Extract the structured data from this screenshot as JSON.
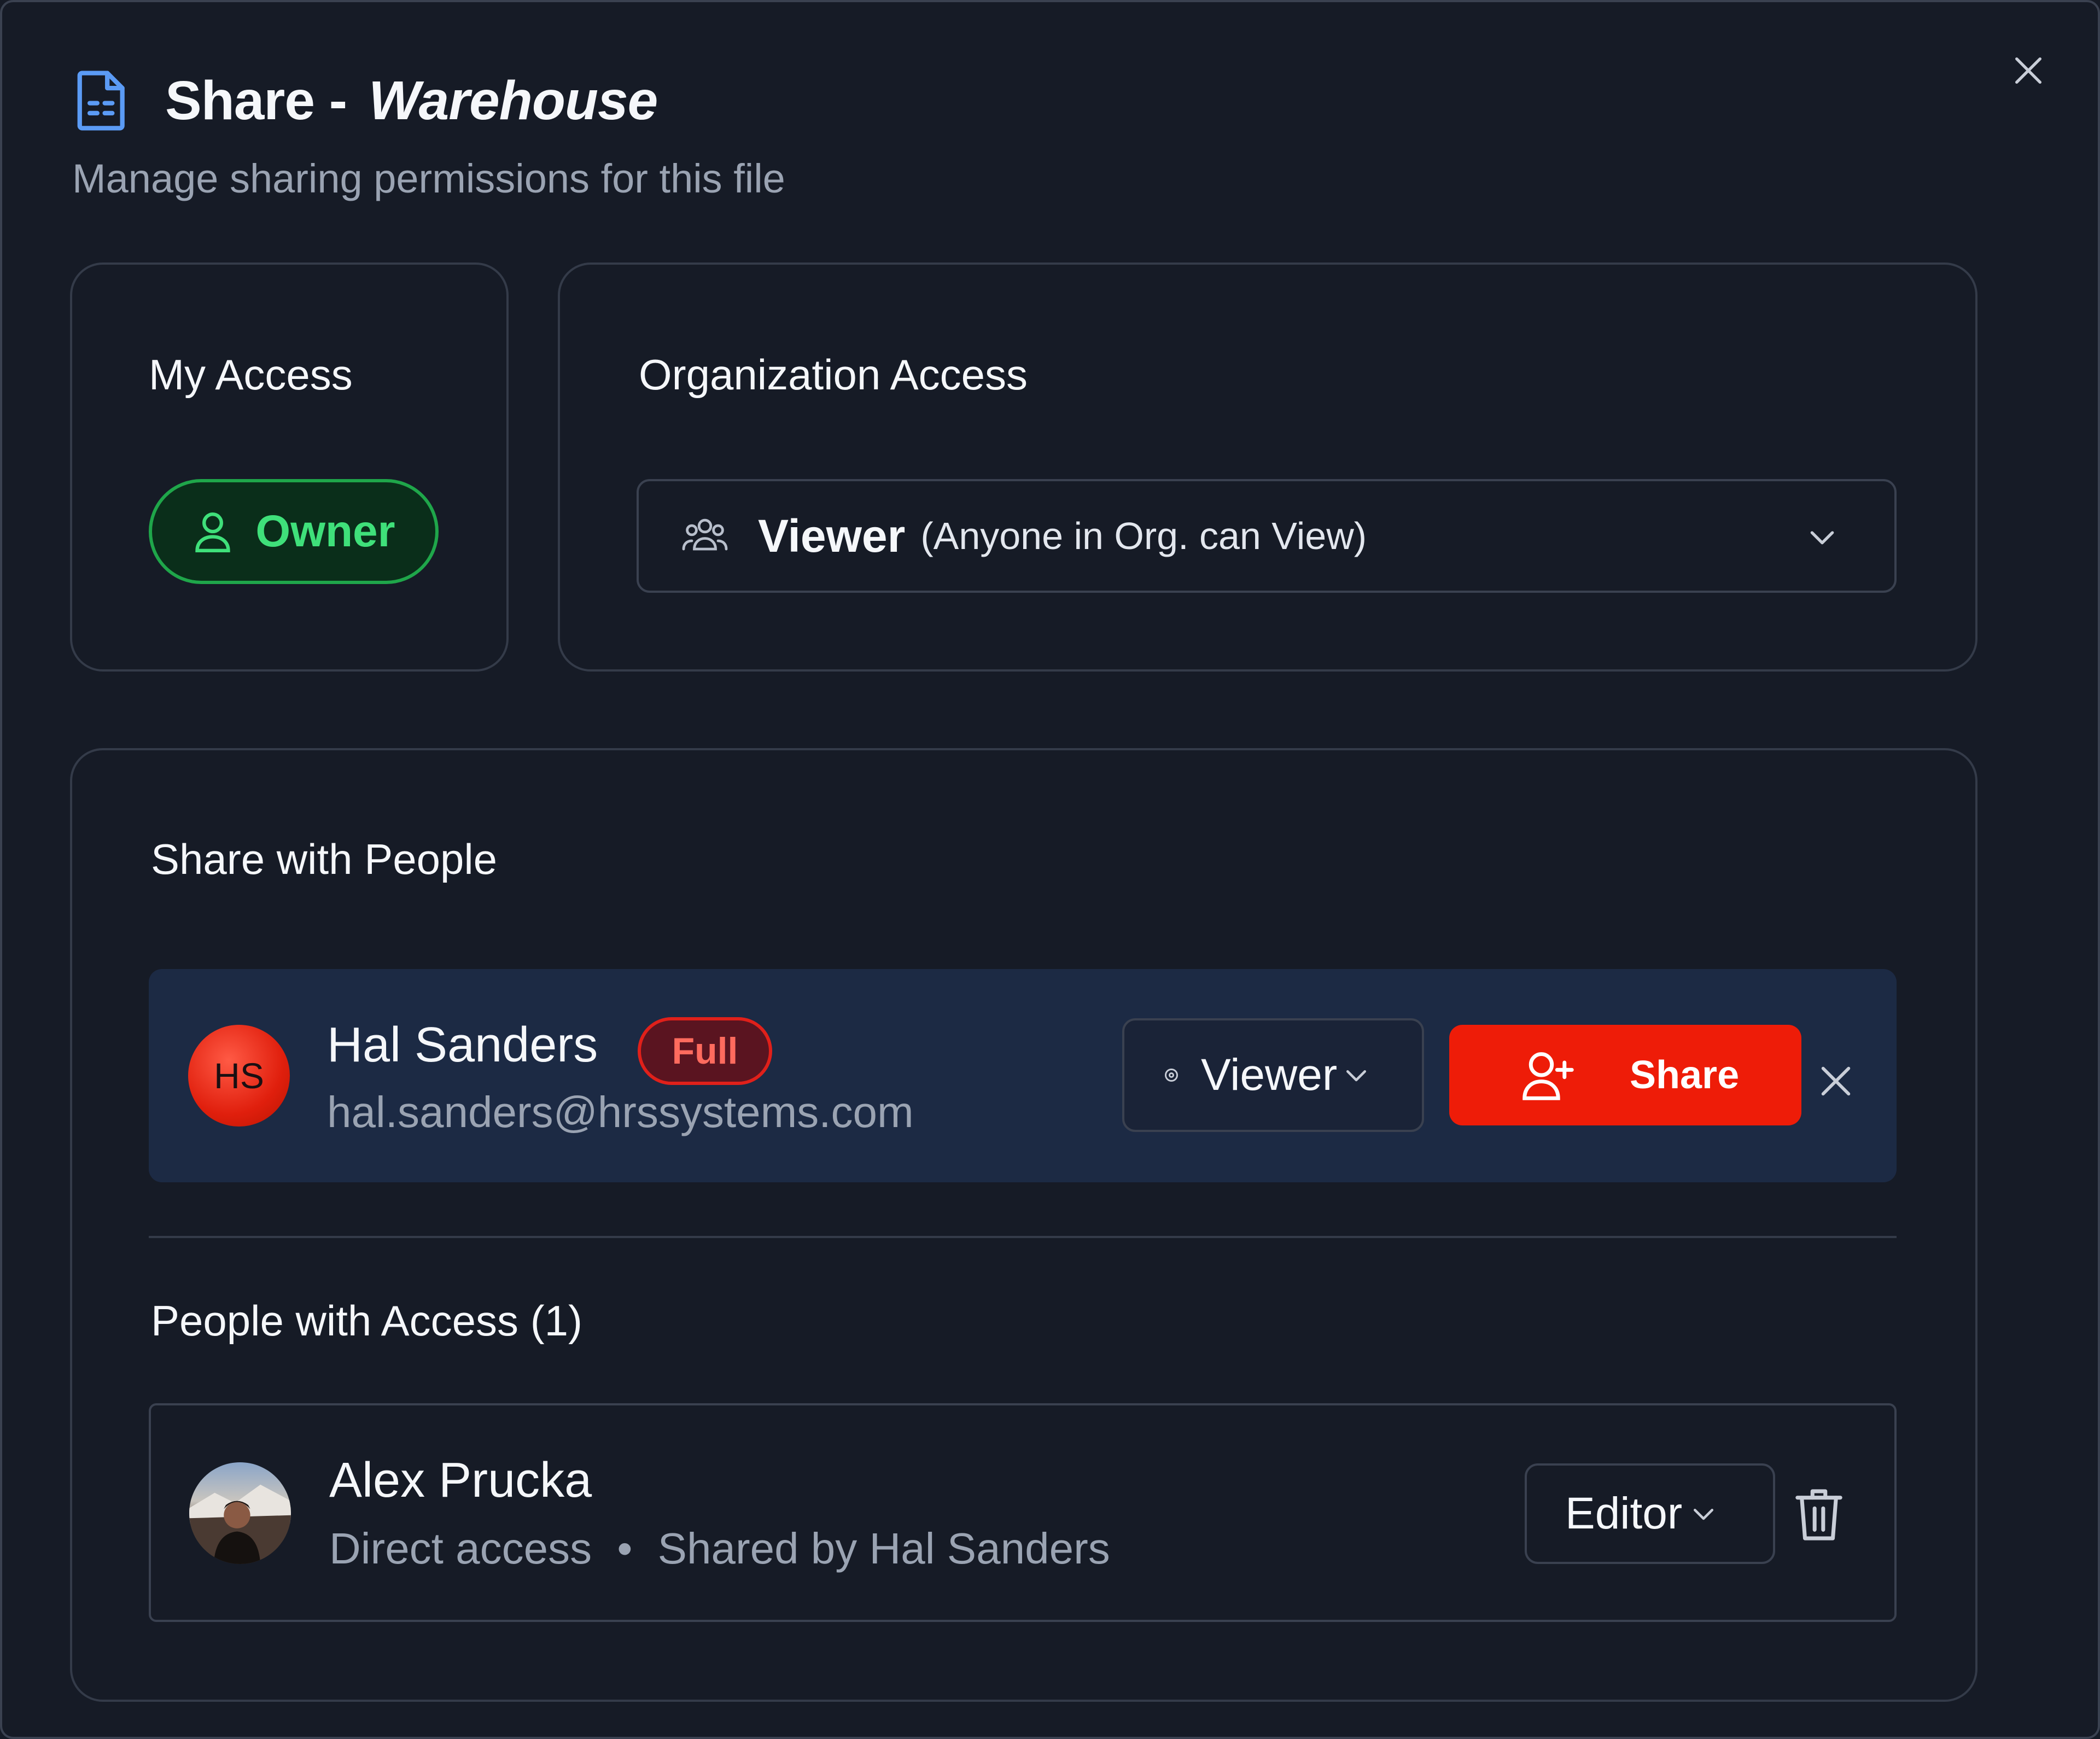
{
  "dialog": {
    "title_prefix": "Share -",
    "file_name": "Warehouse",
    "subtitle": "Manage sharing permissions for this file"
  },
  "my_access": {
    "title": "My Access",
    "role": "Owner",
    "color": "#3fe07a"
  },
  "org_access": {
    "title": "Organization Access",
    "role": "Viewer",
    "description": "(Anyone in Org. can View)"
  },
  "share_people": {
    "title": "Share with People",
    "invitee": {
      "initials": "HS",
      "name": "Hal Sanders",
      "badge": "Full",
      "email": "hal.sanders@hrssystems.com",
      "role": "Viewer",
      "share_label": "Share"
    },
    "accent": "#ee1c08"
  },
  "people_with_access": {
    "title": "People with Access (1)",
    "people": [
      {
        "name": "Alex Prucka",
        "access": "Direct access",
        "separator": "•",
        "shared_by": "Shared by Hal Sanders",
        "role": "Editor"
      }
    ]
  }
}
